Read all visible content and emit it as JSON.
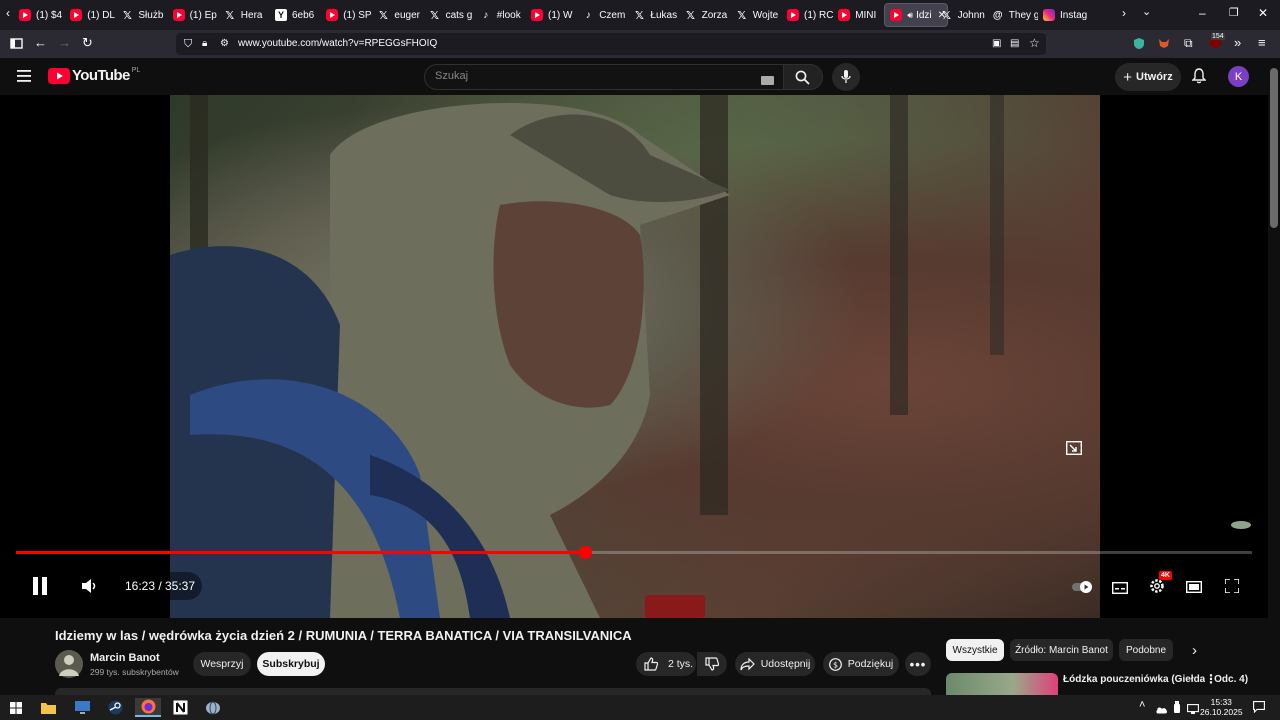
{
  "browser": {
    "tabs": [
      {
        "icon": "youtube-icon",
        "label": "(1) $4"
      },
      {
        "icon": "youtube-icon",
        "label": "(1) DL"
      },
      {
        "icon": "x-icon",
        "label": "Służb"
      },
      {
        "icon": "youtube-icon",
        "label": "(1) Ep"
      },
      {
        "icon": "x-icon",
        "label": "Hera"
      },
      {
        "icon": "ycombinator-icon",
        "label": "6eb6"
      },
      {
        "icon": "youtube-icon",
        "label": "(1) SP"
      },
      {
        "icon": "x-icon",
        "label": "euger"
      },
      {
        "icon": "x-icon",
        "label": "cats g"
      },
      {
        "icon": "tiktok-icon",
        "label": "#look"
      },
      {
        "icon": "youtube-icon",
        "label": "(1) W"
      },
      {
        "icon": "tiktok-icon",
        "label": "Czem"
      },
      {
        "icon": "x-icon",
        "label": "Łukas"
      },
      {
        "icon": "x-icon",
        "label": "Zorza"
      },
      {
        "icon": "x-icon",
        "label": "Wojte"
      },
      {
        "icon": "youtube-icon",
        "label": "(1) RC"
      },
      {
        "icon": "youtube-icon",
        "label": "MINI"
      },
      {
        "icon": "youtube-icon",
        "label": "Idzi",
        "active": true
      },
      {
        "icon": "x-icon",
        "label": "Johnn"
      },
      {
        "icon": "threads-icon",
        "label": "They g"
      },
      {
        "icon": "instagram-icon",
        "label": "Instag"
      }
    ],
    "url": "www.youtube.com/watch?v=RPEGGsFHOIQ",
    "extension_badge": "154"
  },
  "youtube": {
    "logo_text": "YouTube",
    "logo_region": "PL",
    "search_placeholder": "Szukaj",
    "create_label": "Utwórz",
    "avatar_letter": "K"
  },
  "player": {
    "current_time": "16:23",
    "duration": "35:37",
    "time_display": "16:23 / 35:37",
    "progress": 0.46,
    "quality_badge": "4K"
  },
  "video": {
    "title": "Idziemy w las / wędrówka życia dzień 2 / RUMUNIA / TERRA BANATICA / VIA TRANSILVANICA",
    "channel_name": "Marcin Banot",
    "subscribers": "299 tys. subskrybentów",
    "support_label": "Wesprzyj",
    "subscribe_label": "Subskrybuj",
    "likes": "2 tys.",
    "share_label": "Udostępnij",
    "thanks_label": "Podziękuj"
  },
  "recommendations": {
    "chips": [
      "Wszystkie",
      "Źródło: Marcin Banot",
      "Podobne"
    ],
    "first_title": "Łódzka pouczeniówka (Giełda - Odc. 4)"
  },
  "taskbar": {
    "time": "15:33",
    "date": "26.10.2025"
  }
}
